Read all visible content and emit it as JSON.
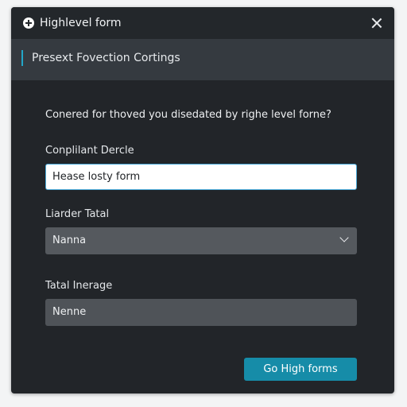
{
  "window": {
    "title": "Highlevel form",
    "title_icon": "plus-circle-icon",
    "close_icon": "close-icon"
  },
  "header": {
    "text": "Presext Fovection Cortings",
    "accent_color": "#22a6c8"
  },
  "form": {
    "question": "Conered for thoved you disedated by righe level forne?",
    "field1": {
      "label": "Conplilant Dercle",
      "value": "Hease losty form"
    },
    "field2": {
      "label": "Liarder Tatal",
      "selected": "Nanna"
    },
    "field3": {
      "label": "Tatal Inerage",
      "value": "Nenne"
    }
  },
  "actions": {
    "primary_label": "Go High forms",
    "primary_color": "#168ca8"
  }
}
